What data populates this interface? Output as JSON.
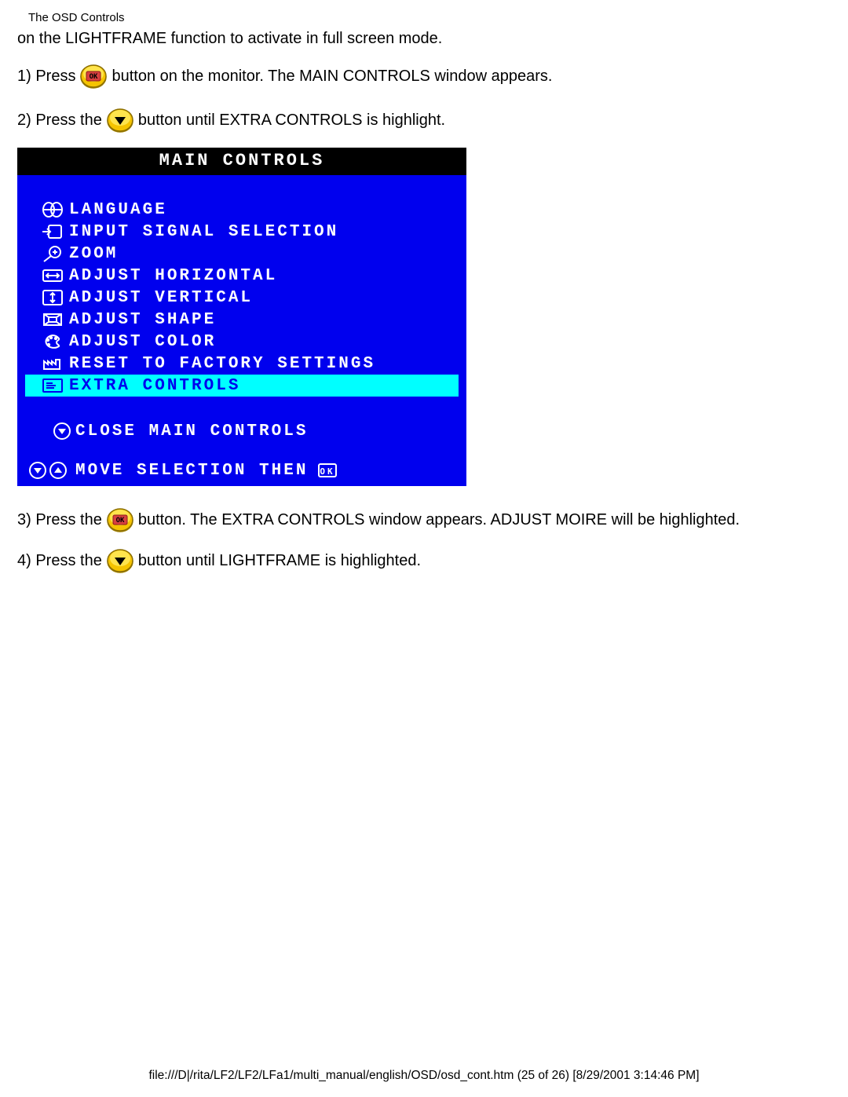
{
  "doc_title": "The OSD Controls",
  "intro": "on the LIGHTFRAME function to activate in full screen mode.",
  "steps": {
    "s1_a": "1) Press",
    "s1_b": "button on the monitor. The MAIN CONTROLS window appears.",
    "s2_a": "2) Press the",
    "s2_b": "button until EXTRA CONTROLS is highlight.",
    "s3_a": "3) Press the",
    "s3_b": "button. The EXTRA CONTROLS window appears. ADJUST MOIRE will be highlighted.",
    "s4_a": "4) Press the",
    "s4_b": "button until LIGHTFRAME is highlighted."
  },
  "osd": {
    "title": "MAIN CONTROLS",
    "items": [
      {
        "label": "LANGUAGE"
      },
      {
        "label": "INPUT SIGNAL SELECTION"
      },
      {
        "label": "ZOOM"
      },
      {
        "label": "ADJUST HORIZONTAL"
      },
      {
        "label": "ADJUST VERTICAL"
      },
      {
        "label": "ADJUST SHAPE"
      },
      {
        "label": "ADJUST COLOR"
      },
      {
        "label": "RESET TO FACTORY SETTINGS"
      },
      {
        "label": "EXTRA CONTROLS"
      }
    ],
    "close": "CLOSE MAIN CONTROLS",
    "footer": "MOVE SELECTION THEN"
  },
  "page_footer": "file:///D|/rita/LF2/LF2/LFa1/multi_manual/english/OSD/osd_cont.htm (25 of 26) [8/29/2001 3:14:46 PM]"
}
